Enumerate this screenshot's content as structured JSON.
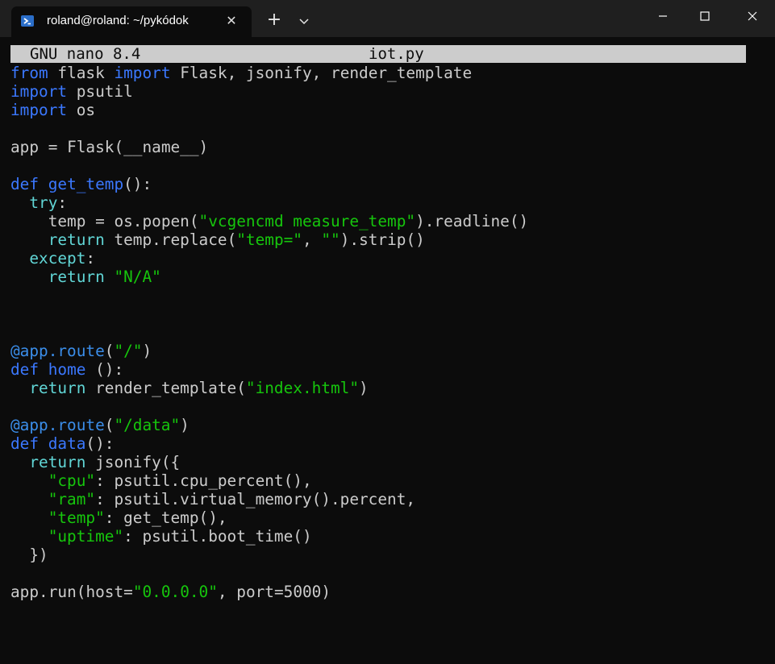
{
  "window": {
    "tab_title": "roland@roland: ~/pykódok",
    "tab_icon": "powershell-icon",
    "close_tab_glyph": "✕",
    "new_tab_glyph": "+"
  },
  "nano": {
    "version": "GNU nano 8.4",
    "filename": "iot.py"
  },
  "code": {
    "lines": [
      "from flask import Flask, jsonify, render_template",
      "import psutil",
      "import os",
      "",
      "app = Flask(__name__)",
      "",
      "def get_temp():",
      "  try:",
      "    temp = os.popen(\"vcgencmd measure_temp\").readline()",
      "    return temp.replace(\"temp=\", \"\").strip()",
      "  except:",
      "    return \"N/A\"",
      "",
      "",
      "",
      "@app.route(\"/\")",
      "def home ():",
      "  return render_template(\"index.html\")",
      "",
      "@app.route(\"/data\")",
      "def data():",
      "  return jsonify({",
      "    \"cpu\": psutil.cpu_percent(),",
      "    \"ram\": psutil.virtual_memory().percent,",
      "    \"temp\": get_temp(),",
      "    \"uptime\": psutil.boot_time()",
      "  })",
      "",
      "app.run(host=\"0.0.0.0\", port=5000)"
    ],
    "cursor_line": 0,
    "cursor_col": 0
  },
  "colors": {
    "terminal_bg": "#0c0c0c",
    "text": "#cccccc",
    "keyword": "#3b78ff",
    "decorator": "#3b8eea",
    "cyan": "#61d6d6",
    "string": "#16c60c",
    "header_bg": "#cccccc"
  }
}
